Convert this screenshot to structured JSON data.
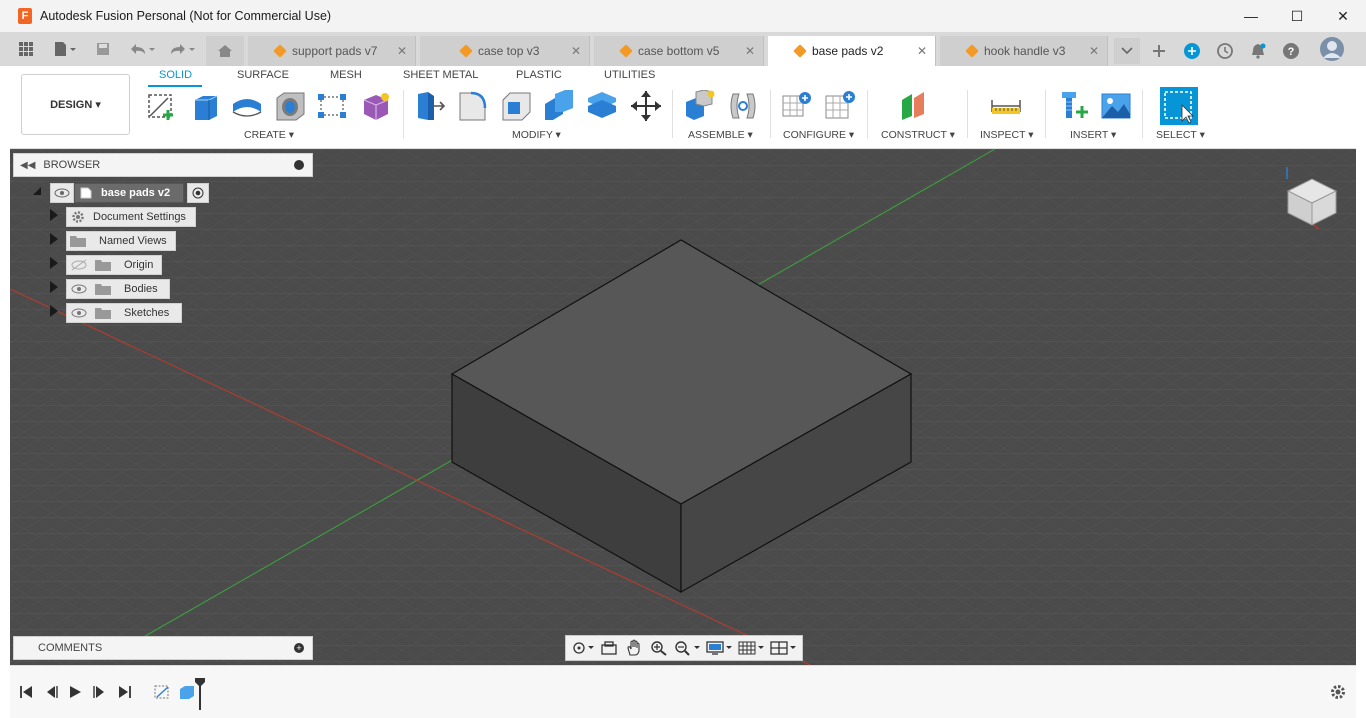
{
  "window": {
    "title": "Autodesk Fusion Personal (Not for Commercial Use)",
    "app_icon_letter": "F",
    "minimize_glyph": "—",
    "maximize_glyph": "☐",
    "close_glyph": "✕"
  },
  "tabs": [
    {
      "label": "support pads v7",
      "active": false
    },
    {
      "label": "case top v3",
      "active": false
    },
    {
      "label": "case bottom v5",
      "active": false
    },
    {
      "label": "base pads v2",
      "active": true
    },
    {
      "label": "hook handle v3",
      "active": false
    }
  ],
  "tab_close_glyph": "✕",
  "workspace": {
    "label": "DESIGN ▾",
    "tabs": [
      "SOLID",
      "SURFACE",
      "MESH",
      "SHEET METAL",
      "PLASTIC",
      "UTILITIES"
    ],
    "active_tab": "SOLID"
  },
  "toolbar_groups": {
    "create": "CREATE ▾",
    "modify": "MODIFY ▾",
    "assemble": "ASSEMBLE ▾",
    "configure": "CONFIGURE ▾",
    "construct": "CONSTRUCT ▾",
    "inspect": "INSPECT ▾",
    "insert": "INSERT ▾",
    "select": "SELECT ▾"
  },
  "browser": {
    "title": "BROWSER",
    "root": "base pads v2",
    "items": [
      {
        "label": "Document Settings",
        "icon": "gear-icon"
      },
      {
        "label": "Named Views",
        "icon": "folder-icon"
      },
      {
        "label": "Origin",
        "icon": "folder-icon",
        "visibility": "hidden"
      },
      {
        "label": "Bodies",
        "icon": "folder-icon",
        "visibility": "visible"
      },
      {
        "label": "Sketches",
        "icon": "folder-icon",
        "visibility": "visible"
      }
    ]
  },
  "comments": {
    "title": "COMMENTS"
  },
  "colors": {
    "accent": "#0696d7",
    "viewport_bg": "#4a4a4a",
    "body_top": "#5a5a5a",
    "body_left": "#3f3f3f",
    "body_right": "#474747",
    "tab_cube": "#f39a26",
    "axis_x": "#c0392b",
    "axis_y": "#3aa63a"
  }
}
